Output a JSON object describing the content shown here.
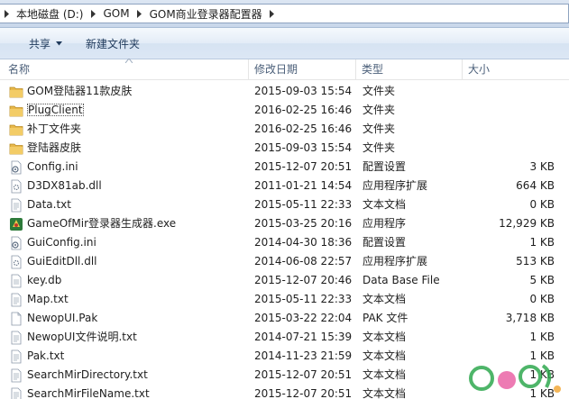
{
  "breadcrumb": {
    "segments": [
      "本地磁盘 (D:)",
      "GOM",
      "GOM商业登录器配置器"
    ]
  },
  "toolbar": {
    "share_label": "共享",
    "newfolder_label": "新建文件夹"
  },
  "columns": {
    "name": "名称",
    "date": "修改日期",
    "type": "类型",
    "size": "大小"
  },
  "files": [
    {
      "name": "GOM登陆器11款皮肤",
      "date": "2015-09-03 15:54",
      "type": "文件夹",
      "size": "",
      "icon": "folder-icon"
    },
    {
      "name": "PlugClient",
      "date": "2016-02-25 16:46",
      "type": "文件夹",
      "size": "",
      "icon": "folder-icon"
    },
    {
      "name": "补丁文件夹",
      "date": "2016-02-25 16:46",
      "type": "文件夹",
      "size": "",
      "icon": "folder-icon"
    },
    {
      "name": "登陆器皮肤",
      "date": "2015-09-03 15:54",
      "type": "文件夹",
      "size": "",
      "icon": "folder-icon"
    },
    {
      "name": "Config.ini",
      "date": "2015-12-07 20:51",
      "type": "配置设置",
      "size": "3 KB",
      "icon": "config-file-icon"
    },
    {
      "name": "D3DX81ab.dll",
      "date": "2011-01-21 14:54",
      "type": "应用程序扩展",
      "size": "664 KB",
      "icon": "dll-file-icon"
    },
    {
      "name": "Data.txt",
      "date": "2015-05-11 22:33",
      "type": "文本文档",
      "size": "0 KB",
      "icon": "text-file-icon"
    },
    {
      "name": "GameOfMir登录器生成器.exe",
      "date": "2015-03-25 20:16",
      "type": "应用程序",
      "size": "12,929 KB",
      "icon": "exe-file-icon"
    },
    {
      "name": "GuiConfig.ini",
      "date": "2014-04-30 18:36",
      "type": "配置设置",
      "size": "1 KB",
      "icon": "config-file-icon"
    },
    {
      "name": "GuiEditDll.dll",
      "date": "2014-06-08 22:57",
      "type": "应用程序扩展",
      "size": "513 KB",
      "icon": "dll-file-icon"
    },
    {
      "name": "key.db",
      "date": "2015-12-07 20:46",
      "type": "Data Base File",
      "size": "5 KB",
      "icon": "db-file-icon"
    },
    {
      "name": "Map.txt",
      "date": "2015-05-11 22:33",
      "type": "文本文档",
      "size": "0 KB",
      "icon": "text-file-icon"
    },
    {
      "name": "NewopUI.Pak",
      "date": "2015-03-22 22:04",
      "type": "PAK 文件",
      "size": "3,718 KB",
      "icon": "generic-file-icon"
    },
    {
      "name": "NewopUI文件说明.txt",
      "date": "2014-07-21 15:39",
      "type": "文本文档",
      "size": "1 KB",
      "icon": "text-file-icon"
    },
    {
      "name": "Pak.txt",
      "date": "2014-11-23 21:59",
      "type": "文本文档",
      "size": "1 KB",
      "icon": "text-file-icon"
    },
    {
      "name": "SearchMirDirectory.txt",
      "date": "2015-12-07 20:51",
      "type": "文本文档",
      "size": "1 KB",
      "icon": "text-file-icon"
    },
    {
      "name": "SearchMirFileName.txt",
      "date": "2015-12-07 20:51",
      "type": "文本文档",
      "size": "1 KB",
      "icon": "text-file-icon"
    }
  ],
  "colors": {
    "folder": "#e8b84a",
    "header_text": "#4c607a",
    "toolbar_text": "#1e395b",
    "watermark": "#2fa84f"
  }
}
